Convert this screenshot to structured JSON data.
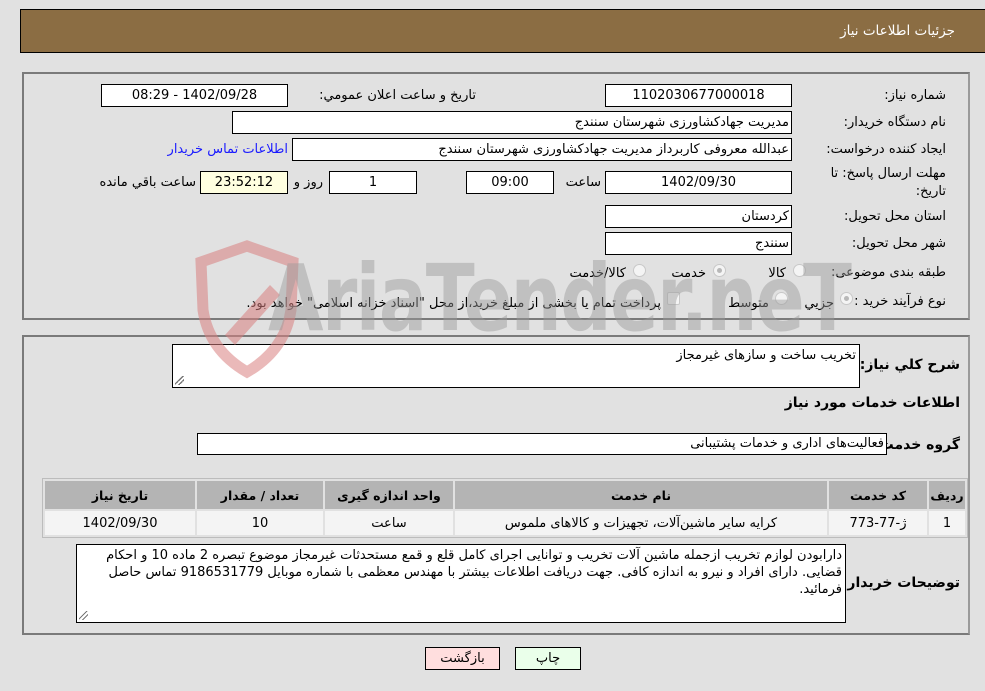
{
  "header": {
    "title": "جزئیات اطلاعات نیاز"
  },
  "info": {
    "need_number_label": "شماره نیاز:",
    "need_number": "1102030677000018",
    "announce_label": "تاریخ و ساعت اعلان عمومي:",
    "announce_value": "1402/09/28 - 08:29",
    "buyer_org_label": "نام دستگاه خریدار:",
    "buyer_org": "مدیریت جهادکشاورزی شهرستان سنندج",
    "creator_label": "ایجاد کننده درخواست:",
    "creator": "عبدالله معروفی کاربرداز مدیریت جهادکشاورزی شهرستان سنندج",
    "contact_link": "اطلاعات تماس خریدار",
    "deadline_label": "مهلت ارسال پاسخ: تا تاریخ:",
    "deadline_date": "1402/09/30",
    "time_label": "ساعت",
    "deadline_time": "09:00",
    "days_value": "1",
    "days_label": "روز و",
    "remaining_time": "23:52:12",
    "remaining_label": "ساعت باقي مانده",
    "province_label": "استان محل تحویل:",
    "province": "کردستان",
    "city_label": "شهر محل تحویل:",
    "city": "سنندج",
    "category_label": "طبقه بندی موضوعی:",
    "category_options": [
      "کالا",
      "خدمت",
      "کالا/خدمت"
    ],
    "category_selected": "خدمت",
    "process_label": "نوع فرآیند خرید :",
    "process_options": [
      "جزيي",
      "متوسط"
    ],
    "process_selected": "جزيي",
    "treasury_note": "پرداخت تمام یا بخشی از مبلغ خرید،از محل \"اسناد خزانه اسلامی\" خواهد بود."
  },
  "details": {
    "summary_label": "شرح کلي نياز:",
    "summary": "تخریب ساخت و سازهای غیرمجاز",
    "services_title": "اطلاعات خدمات مورد نیاز",
    "service_group_label": "گروه خدمت:",
    "service_group": "فعالیت‌های اداری و خدمات پشتیبانی",
    "table": {
      "headers": [
        "ردیف",
        "کد خدمت",
        "نام خدمت",
        "واحد اندازه گیری",
        "تعداد / مقدار",
        "تاریخ نیاز"
      ],
      "rows": [
        [
          "1",
          "ژ-77-773",
          "کرایه سایر ماشین‌آلات، تجهیزات و کالاهای ملموس",
          "ساعت",
          "10",
          "1402/09/30"
        ]
      ]
    },
    "buyer_notes_label": "توضیحات خریدار:",
    "buyer_notes": "دارابودن لوازم تخریب ازجمله ماشین آلات تخریب و توانایی اجرای کامل قلع و قمع مستحدثات غیرمجاز موضوع تبصره 2 ماده 10 و احکام قضایی. دارای افراد و نیرو به اندازه کافی. جهت دریافت اطلاعات بیشتر با مهندس معظمی با شماره موبایل 9186531779 تماس حاصل فرمائید."
  },
  "buttons": {
    "print": "چاپ",
    "back": "بازگشت"
  },
  "watermark": {
    "text": "AriaTender.neT"
  },
  "colors": {
    "header_bg": "#8b6d43",
    "link": "#1a1aff",
    "print_bg": "#eaffea",
    "back_bg": "#ffdede",
    "remaining_bg": "#ffffe0"
  }
}
